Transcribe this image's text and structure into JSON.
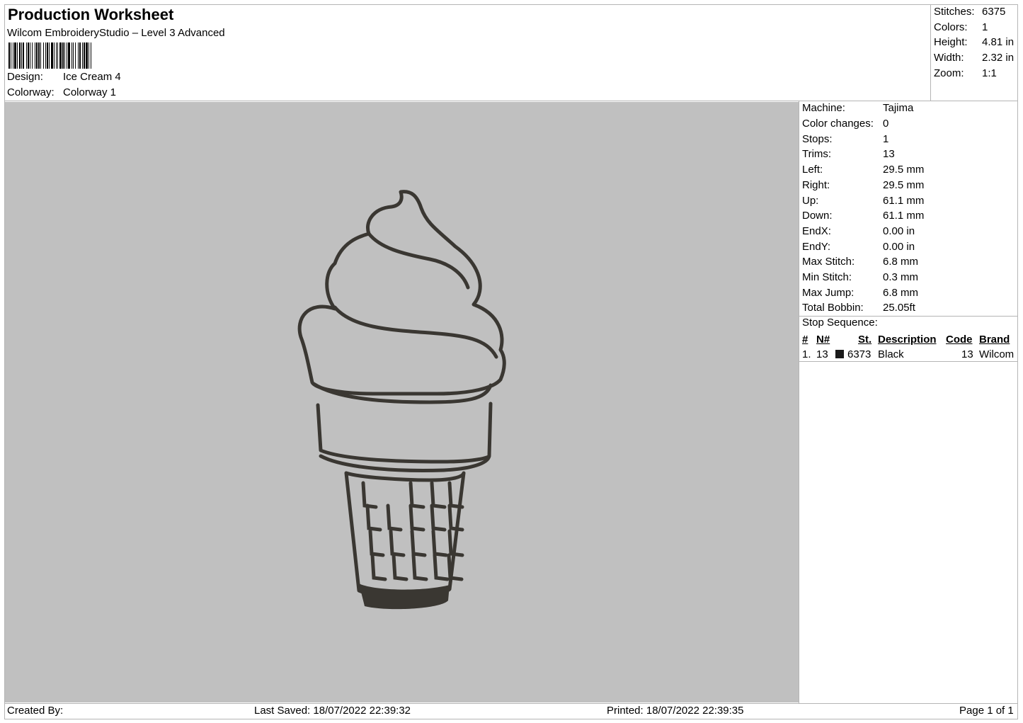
{
  "header": {
    "title": "Production Worksheet",
    "software": "Wilcom EmbroideryStudio – Level 3 Advanced",
    "design_label": "Design:",
    "design_value": "Ice Cream 4",
    "colorway_label": "Colorway:",
    "colorway_value": "Colorway 1"
  },
  "stats": [
    {
      "label": "Stitches:",
      "value": "6375"
    },
    {
      "label": "Colors:",
      "value": "1"
    },
    {
      "label": "Height:",
      "value": "4.81 in"
    },
    {
      "label": "Width:",
      "value": "2.32 in"
    },
    {
      "label": "Zoom:",
      "value": "1:1"
    }
  ],
  "machine": [
    {
      "label": "Machine:",
      "value": "Tajima"
    },
    {
      "label": "Color changes:",
      "value": "0"
    },
    {
      "label": "Stops:",
      "value": "1"
    },
    {
      "label": "Trims:",
      "value": "13"
    },
    {
      "label": "Left:",
      "value": "29.5 mm"
    },
    {
      "label": "Right:",
      "value": "29.5 mm"
    },
    {
      "label": "Up:",
      "value": "61.1 mm"
    },
    {
      "label": "Down:",
      "value": "61.1 mm"
    },
    {
      "label": "EndX:",
      "value": "0.00 in"
    },
    {
      "label": "EndY:",
      "value": "0.00 in"
    },
    {
      "label": "Max Stitch:",
      "value": "6.8 mm"
    },
    {
      "label": "Min Stitch:",
      "value": "0.3 mm"
    },
    {
      "label": "Max Jump:",
      "value": "6.8 mm"
    },
    {
      "label": "Total Bobbin:",
      "value": "25.05ft"
    }
  ],
  "stop_sequence": {
    "title": "Stop Sequence:",
    "headers": {
      "num": "#",
      "n": "N#",
      "st": "St.",
      "description": "Description",
      "code": "Code",
      "brand": "Brand"
    },
    "rows": [
      {
        "num": "1.",
        "n": "13",
        "swatch_color": "#1a1a1a",
        "st": "6373",
        "description": "Black",
        "code": "13",
        "brand": "Wilcom"
      }
    ]
  },
  "footer": {
    "created_by": "Created By:",
    "last_saved": "Last Saved: 18/07/2022 22:39:32",
    "printed": "Printed: 18/07/2022 22:39:35",
    "page": "Page 1 of 1"
  },
  "design_preview": {
    "background": "#c0c0c0",
    "thread_color": "#3a3732"
  }
}
